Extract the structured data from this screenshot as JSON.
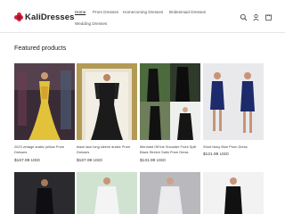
{
  "brand": {
    "name": "KaliDresses",
    "accent": "#d61f3d"
  },
  "nav": {
    "items": [
      {
        "label": "Home",
        "active": true
      },
      {
        "label": "Prom Dresses",
        "active": false
      },
      {
        "label": "Homecoming Dresses",
        "active": false
      },
      {
        "label": "Bridesmaid Dresses",
        "active": false
      },
      {
        "label": "Wedding Dresses",
        "active": false
      }
    ]
  },
  "header_icons": [
    "search-icon",
    "account-icon",
    "cart-icon"
  ],
  "section": {
    "title": "Featured products"
  },
  "products": [
    {
      "title": "2023 vintage arabic yellow Prom Dresses",
      "price": "$167.99 USD"
    },
    {
      "title": "black lace long sleeve arabic Prom Dresses",
      "price": "$167.99 USD"
    },
    {
      "title": "Mermaid Off the Shoulder Front Split Black Stretch Satin Prom Dress",
      "price": "$131.99 USD"
    },
    {
      "title": "Short Navy Blue Prom Dress",
      "price": "$121.99 USD"
    }
  ]
}
